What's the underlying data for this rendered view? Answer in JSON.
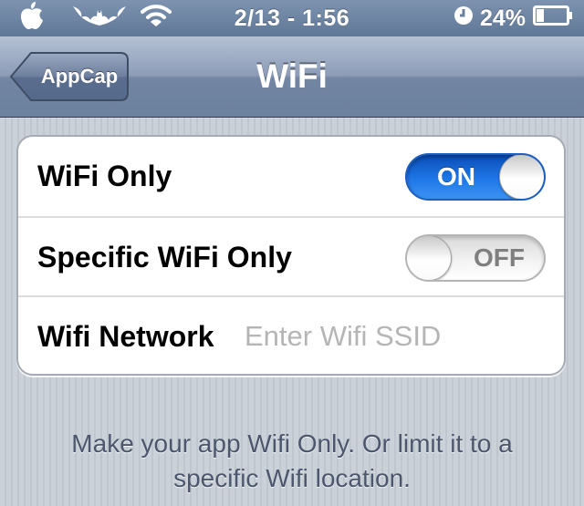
{
  "status_bar": {
    "time": "2/13 - 1:56",
    "battery_percent": "24%",
    "battery_level": 0.24,
    "icons": [
      "apple-icon",
      "batman-signal-icon",
      "wifi-icon",
      "alarm-clock-icon",
      "battery-icon"
    ]
  },
  "nav_bar": {
    "back_label": "AppCap",
    "title": "WiFi"
  },
  "settings": {
    "rows": [
      {
        "label": "WiFi Only",
        "control": "toggle",
        "state": "ON"
      },
      {
        "label": "Specific WiFi Only",
        "control": "toggle",
        "state": "OFF"
      },
      {
        "label": "Wifi Network",
        "control": "text-input",
        "value": "",
        "placeholder": "Enter Wifi SSID"
      }
    ]
  },
  "footer": {
    "text": "Make your app Wifi Only. Or limit it to a specific Wifi location."
  },
  "colors": {
    "nav_bar": "#7286a4",
    "toggle_on": "#1e77e8",
    "background": "#c5ccd4",
    "footer_text": "#4c566c"
  }
}
